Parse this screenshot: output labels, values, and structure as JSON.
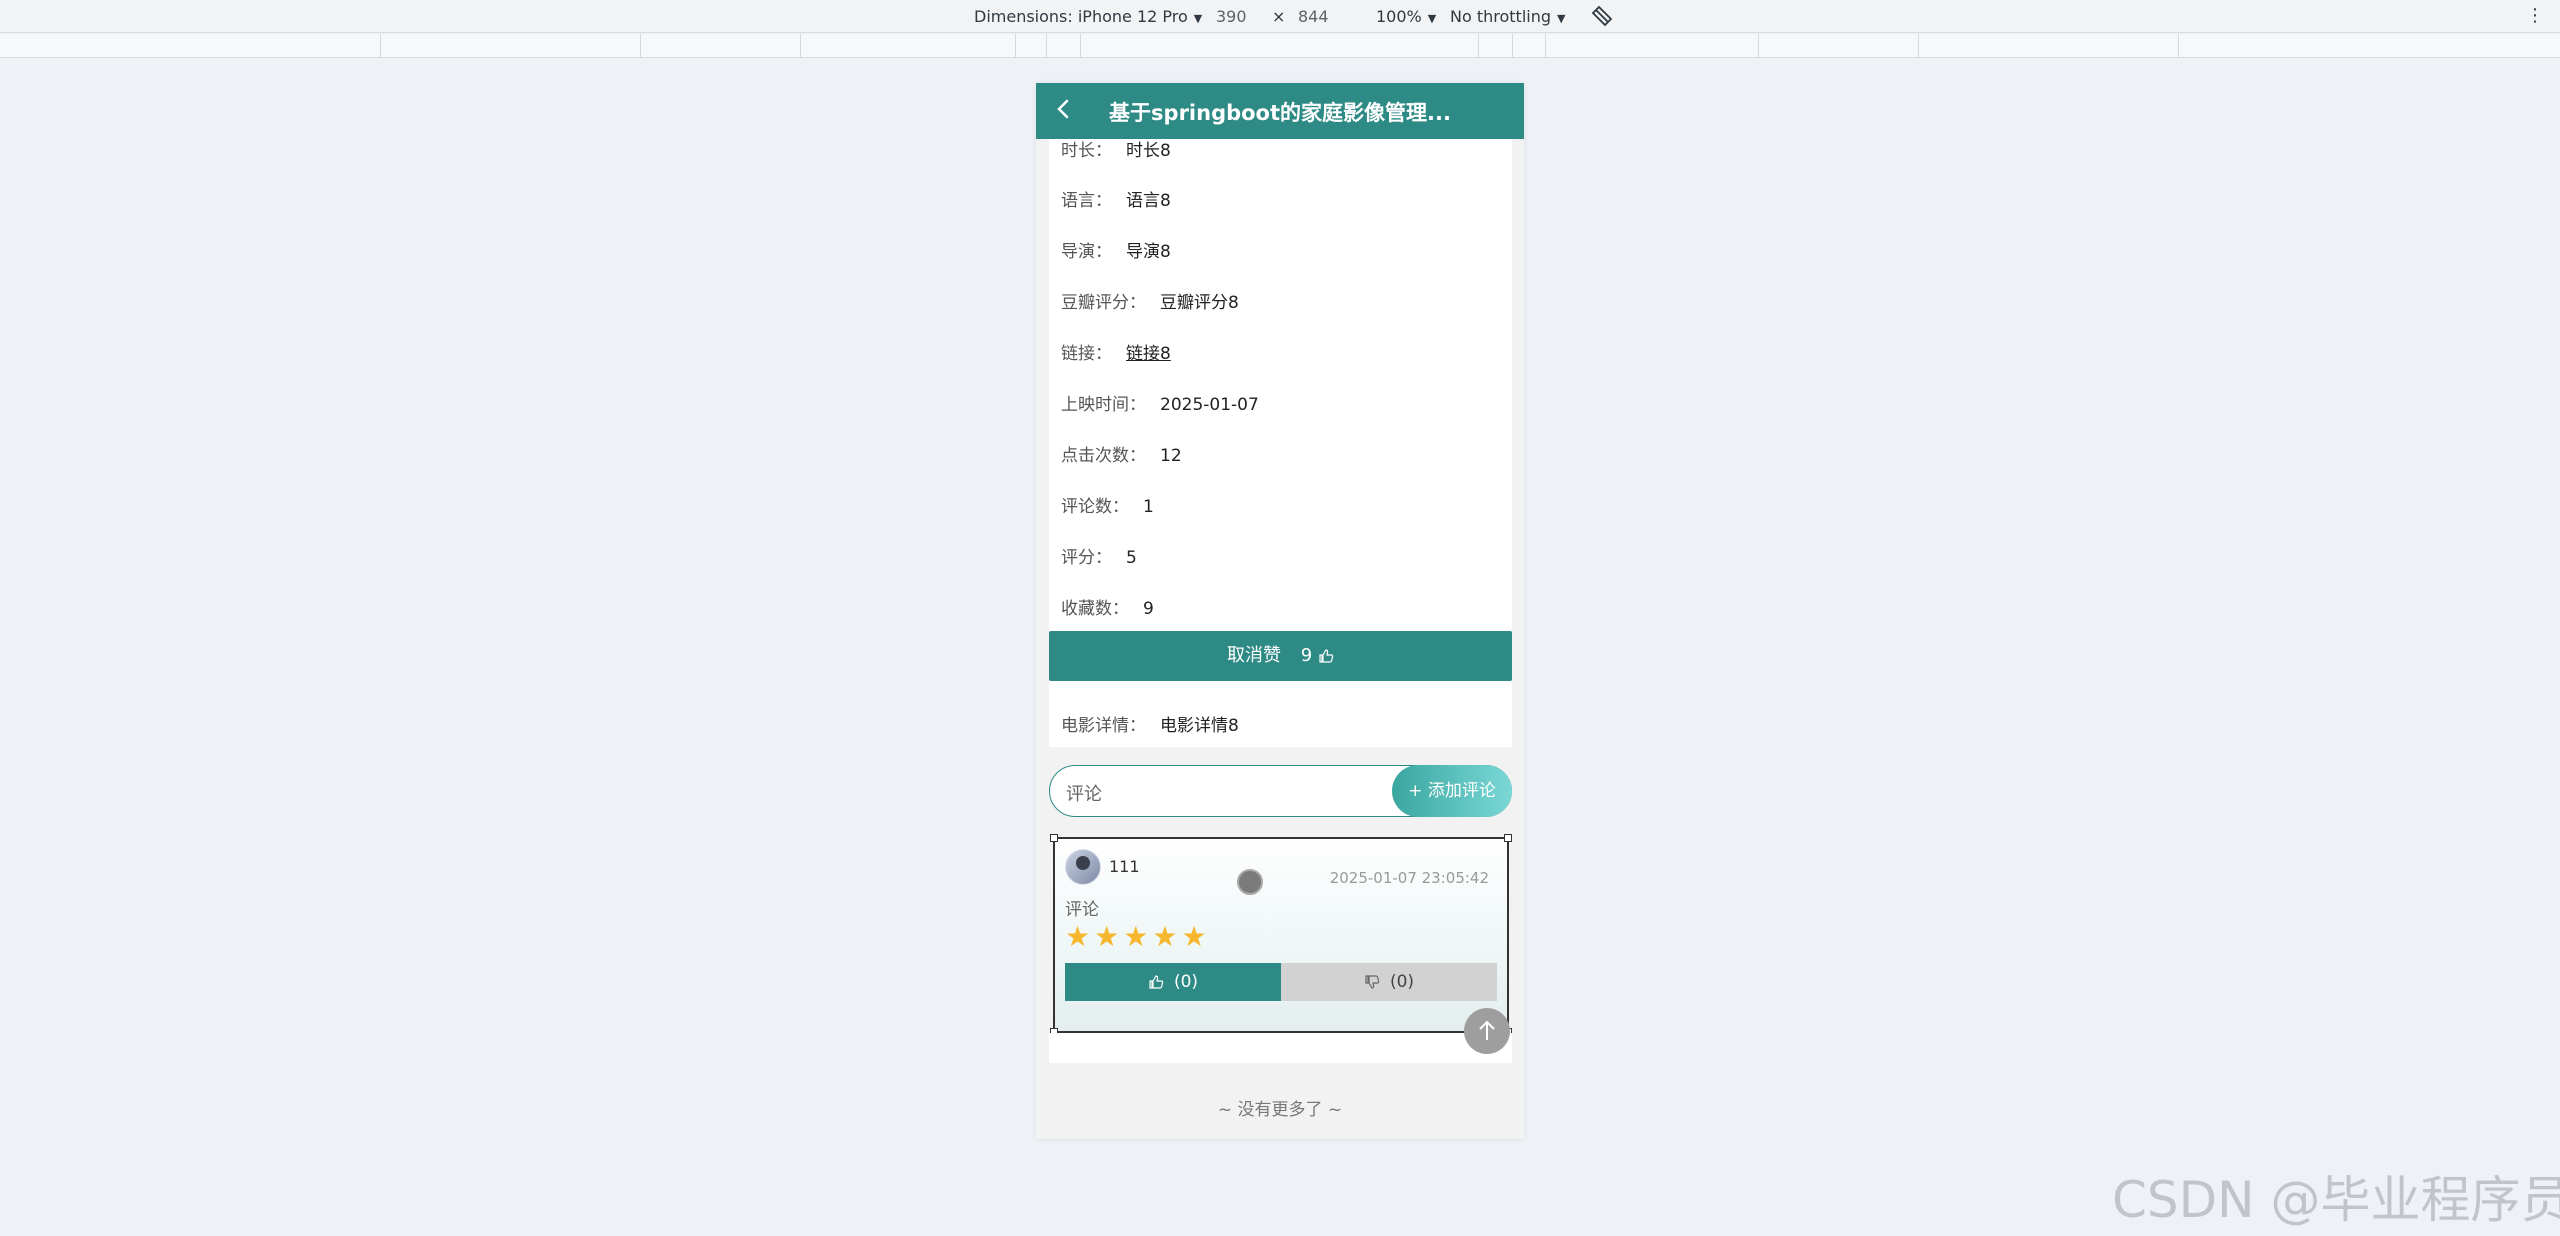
{
  "devtools": {
    "dimensions_label": "Dimensions: iPhone 12 Pro",
    "width": "390",
    "times": "×",
    "height": "844",
    "zoom": "100%",
    "throttling": "No throttling",
    "more_menu": "⋮"
  },
  "header": {
    "title": "基于springboot的家庭影像管理..."
  },
  "details": [
    {
      "label": "时长：",
      "value": "时长8"
    },
    {
      "label": "语言：",
      "value": "语言8"
    },
    {
      "label": "导演：",
      "value": "导演8"
    },
    {
      "label": "豆瓣评分：",
      "value": "豆瓣评分8"
    },
    {
      "label": "链接：",
      "value": "链接8"
    },
    {
      "label": "上映时间：",
      "value": "2025-01-07"
    },
    {
      "label": "点击次数：",
      "value": "12"
    },
    {
      "label": "评论数：",
      "value": "1"
    },
    {
      "label": "评分：",
      "value": "5"
    },
    {
      "label": "收藏数：",
      "value": "9"
    }
  ],
  "like_button": {
    "label": "取消赞",
    "count": "9"
  },
  "movie_detail": {
    "label": "电影详情：",
    "value": "电影详情8"
  },
  "comment_input": {
    "placeholder": "评论",
    "add_label": "+ 添加评论"
  },
  "comment": {
    "username": "111",
    "time": "2025-01-07 23:05:42",
    "text": "评论",
    "rating": 5,
    "max_rating": 5,
    "upvotes": "(0)",
    "downvotes": "(0)"
  },
  "footer": {
    "no_more": "~ 没有更多了 ~"
  },
  "watermark": "CSDN @毕业程序员",
  "colors": {
    "primary": "#2e8a85",
    "star": "#f5b72d"
  },
  "icons": [
    "back-arrow-icon",
    "thumbs-up-icon",
    "thumbs-down-icon",
    "star-icon",
    "arrow-up-icon",
    "rotate-icon"
  ]
}
